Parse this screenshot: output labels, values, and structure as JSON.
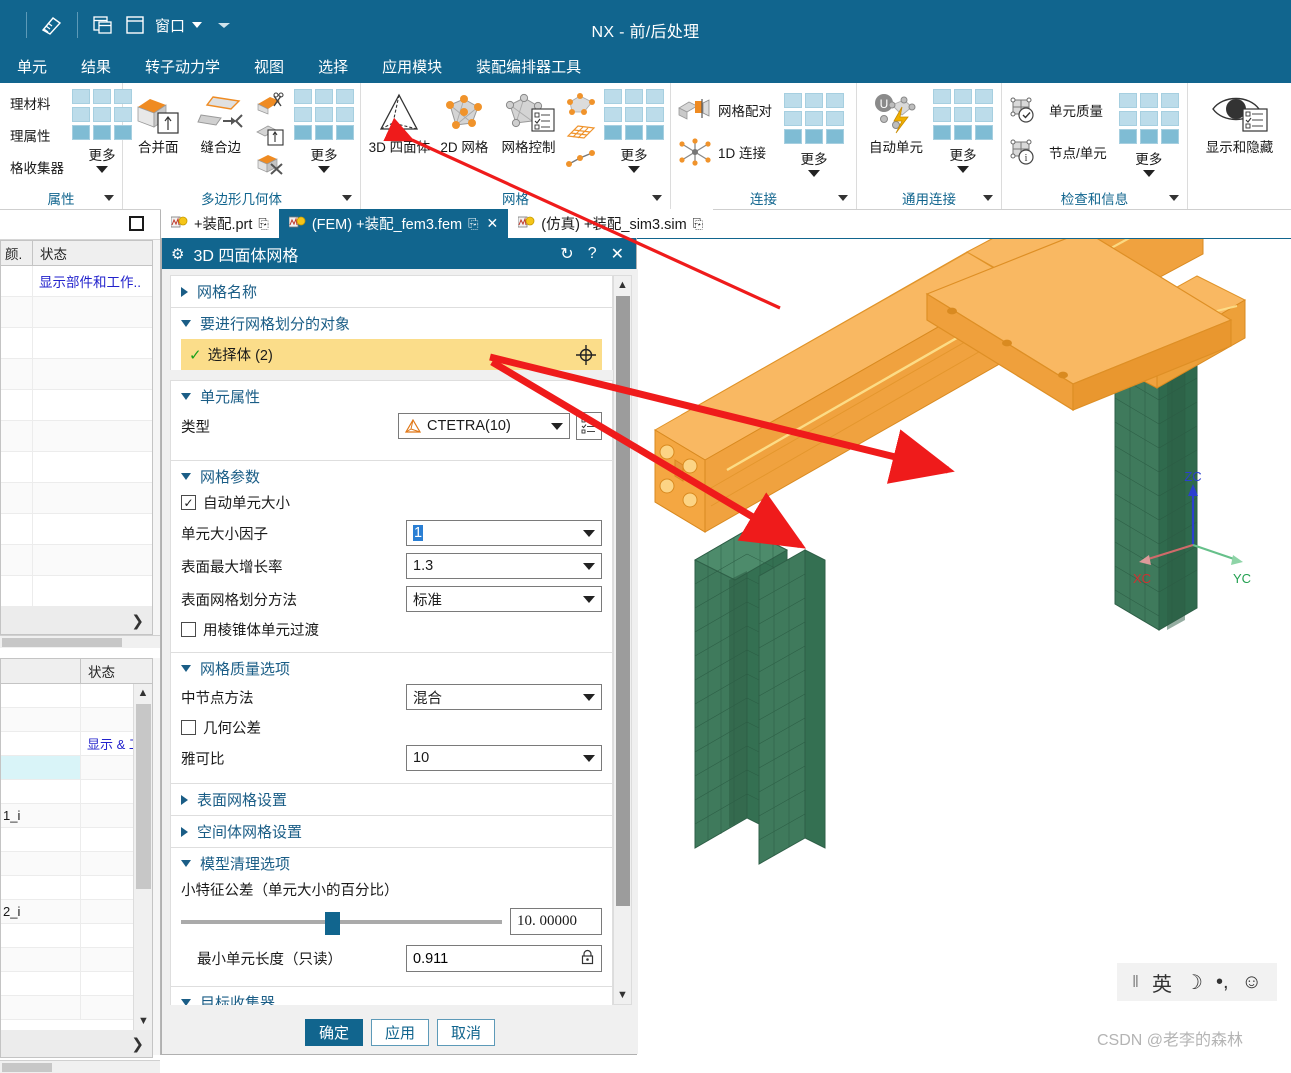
{
  "titlebar": {
    "title": "NX - 前/后处理",
    "quick_access": [
      {
        "name": "pointer-tool-icon",
        "label": ""
      },
      {
        "name": "window-cascade-icon",
        "label": ""
      },
      {
        "name": "window-icon",
        "label": "窗口"
      }
    ],
    "window_label": "窗口"
  },
  "menubar": {
    "items": [
      "单元",
      "结果",
      "转子动力学",
      "视图",
      "选择",
      "应用模块",
      "装配编排器工具"
    ]
  },
  "ribbon": {
    "groups": [
      {
        "name": "属性",
        "footer": "属性",
        "text_items": [
          "理材料",
          "理属性",
          "格收集器"
        ],
        "gallery_more": "更多"
      },
      {
        "name": "多边形几何体",
        "footer": "多边形几何体",
        "buttons": [
          "合并面",
          "缝合边"
        ],
        "gallery_more": "更多"
      },
      {
        "name": "网格",
        "footer": "网格",
        "buttons": [
          "3D 四面体",
          "2D 网格",
          "网格控制"
        ],
        "gallery_more": "更多"
      },
      {
        "name": "连接",
        "footer": "连接",
        "small_items": [
          "网格配对",
          "1D 连接"
        ],
        "gallery_more": "更多"
      },
      {
        "name": "通用连接",
        "footer": "通用连接",
        "buttons": [
          "自动单元"
        ],
        "gallery_more": "更多"
      },
      {
        "name": "检查和信息",
        "footer": "检查和信息",
        "small_items": [
          "单元质量",
          "节点/单元"
        ],
        "gallery_more": "更多"
      },
      {
        "name": "显示和隐藏",
        "footer": "",
        "buttons": [
          "显示和隐藏"
        ]
      }
    ]
  },
  "tabs": [
    {
      "label": "+装配.prt",
      "active": false,
      "has_close": false,
      "modified_mark": "⎘"
    },
    {
      "label": "(FEM) +装配_fem3.fem",
      "active": true,
      "has_close": true,
      "modified_mark": "⎘"
    },
    {
      "label": "(仿真) +装配_sim3.sim",
      "active": false,
      "has_close": false,
      "modified_mark": "⎘"
    }
  ],
  "left_panel": {
    "nav1": {
      "columns": [
        "颜.",
        "状态"
      ],
      "first_row_value": "显示部件和工作..",
      "expand_glyph": "❯",
      "row_count": 12
    },
    "nav2": {
      "columns": [
        "",
        "状态"
      ],
      "rows": [
        {
          "c1": "",
          "c2": ""
        },
        {
          "c1": "",
          "c2": ""
        },
        {
          "c1": "",
          "c2": "显示 & 工"
        },
        {
          "c1": "",
          "c2": "",
          "highlight": true
        },
        {
          "c1": "",
          "c2": ""
        },
        {
          "c1": "1_i",
          "c2": ""
        },
        {
          "c1": "",
          "c2": ""
        },
        {
          "c1": "",
          "c2": ""
        },
        {
          "c1": "",
          "c2": ""
        },
        {
          "c1": "2_i",
          "c2": ""
        },
        {
          "c1": "",
          "c2": ""
        },
        {
          "c1": "",
          "c2": ""
        },
        {
          "c1": "",
          "c2": ""
        },
        {
          "c1": "",
          "c2": ""
        }
      ],
      "expand_glyph": "❯"
    }
  },
  "dialog": {
    "title": "3D 四面体网格",
    "title_icons": {
      "gear": "⚙",
      "reset": "↻",
      "help": "?",
      "close": "✕"
    },
    "sections": {
      "mesh_name": {
        "label": "网格名称",
        "expanded": false
      },
      "objects_to_mesh": {
        "label": "要进行网格划分的对象",
        "expanded": true,
        "select_body": {
          "label": "选择体 (2)",
          "check": "✓",
          "target_icon": "crosshair-icon"
        }
      },
      "element_properties": {
        "label": "单元属性",
        "expanded": true,
        "type_label": "类型",
        "type_value": "CTETRA(10)"
      },
      "mesh_parameters": {
        "label": "网格参数",
        "expanded": true,
        "auto_element_size": {
          "label": "自动单元大小",
          "checked": true
        },
        "element_size_factor": {
          "label": "单元大小因子",
          "value": "1"
        },
        "max_growth_rate": {
          "label": "表面最大增长率",
          "value": "1.3"
        },
        "surface_mesh_method": {
          "label": "表面网格划分方法",
          "value": "标准"
        },
        "pyramid_transition": {
          "label": "用棱锥体单元过渡",
          "checked": false
        }
      },
      "mesh_quality": {
        "label": "网格质量选项",
        "expanded": true,
        "midnode_method": {
          "label": "中节点方法",
          "value": "混合"
        },
        "geometry_tolerance": {
          "label": "几何公差",
          "checked": false
        },
        "jacobian": {
          "label": "雅可比",
          "value": "10"
        }
      },
      "surface_mesh_settings": {
        "label": "表面网格设置",
        "expanded": false
      },
      "volume_mesh_settings": {
        "label": "空间体网格设置",
        "expanded": false
      },
      "model_cleanup": {
        "label": "模型清理选项",
        "expanded": true,
        "small_feature_tol": {
          "label": "小特征公差（单元大小的百分比）",
          "value": "10. 00000",
          "slider_pct": 45
        },
        "min_element_length": {
          "label": "最小单元长度（只读）",
          "value": "0.911",
          "lock_icon": "lock-icon"
        }
      },
      "destination_collector": {
        "label": "目标收集器",
        "expanded": true
      }
    },
    "buttons": {
      "ok": "确定",
      "apply": "应用",
      "cancel": "取消"
    }
  },
  "viewport": {
    "triad": {
      "x": "XC",
      "y": "YC",
      "z": "ZC"
    },
    "model_colors": {
      "solid_orange": "#f5a43c",
      "mesh_green": "#3f7a5c"
    }
  },
  "ime": {
    "items": [
      "英",
      "☽",
      "•,",
      "☺"
    ],
    "separator": "‖"
  },
  "watermark": "CSDN @老李的森林"
}
